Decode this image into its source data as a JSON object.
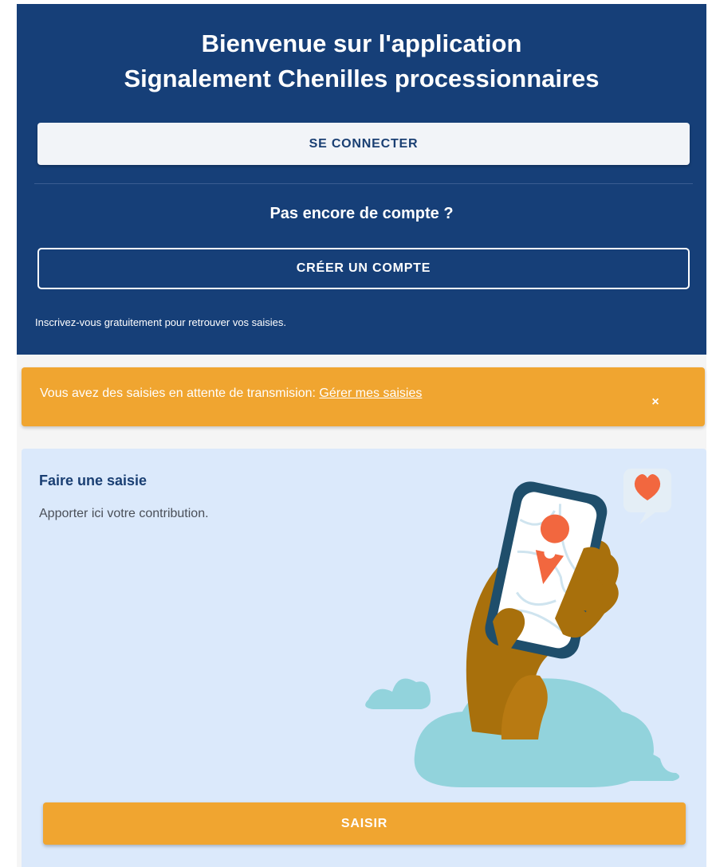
{
  "header": {
    "title_line1": "Bienvenue sur l'application",
    "title_line2": "Signalement Chenilles processionnaires",
    "login_label": "SE CONNECTER",
    "no_account": "Pas encore de compte ?",
    "create_label": "CRÉER UN COMPTE",
    "signup_note": "Inscrivez-vous gratuitement pour retrouver vos saisies."
  },
  "alert": {
    "text": "Vous avez des saisies en attente de transmision: ",
    "link": "Gérer mes saisies",
    "close": "×"
  },
  "card": {
    "title": "Faire une saisie",
    "text": "Apporter ici votre contribution.",
    "button_label": "SAISIR",
    "illustration_icon": "hand-holding-phone-map-pin-icon"
  },
  "colors": {
    "header_bg": "#163f78",
    "accent_orange": "#f0a530",
    "card_bg": "#dbe9fb"
  }
}
